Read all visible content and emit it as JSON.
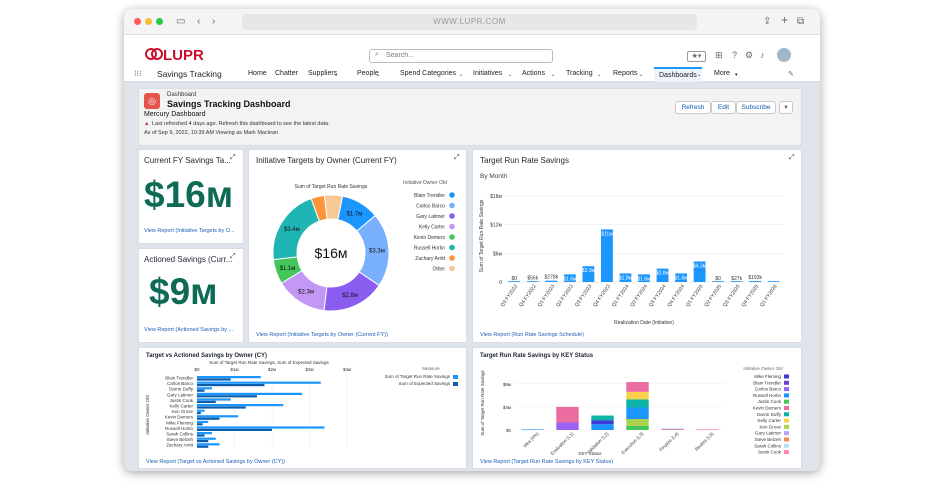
{
  "browser": {
    "url": "WWW.LUPR.COM"
  },
  "header": {
    "logo": "LUPR",
    "search_placeholder": "Search..."
  },
  "nav": {
    "app_name": "Savings Tracking",
    "items": [
      "Home",
      "Chatter",
      "Suppliers",
      "People",
      "Spend Categories",
      "Initiatives",
      "Actions",
      "Tracking",
      "Reports",
      "Dashboards",
      "More"
    ]
  },
  "dashboard": {
    "type_label": "Dashboard",
    "title": "Savings Tracking Dashboard",
    "subtitle": "Mercury Dashboard",
    "warning": "Last refreshed 4 days ago. Refresh this dashboard to see the latest data.",
    "as_of": "As of Sep 9, 2022, 10:39 AM Viewing as Mark Maclean",
    "buttons": {
      "refresh": "Refresh",
      "edit": "Edit",
      "subscribe": "Subscribe"
    }
  },
  "cards": {
    "fy": {
      "title": "Current FY Savings Ta...",
      "value": "$16м",
      "link": "View Report (Initiative Targets by O..."
    },
    "actioned": {
      "title": "Actioned Savings (Curr...",
      "value": "$9м",
      "link": "View Report (Actioned Savings by ..."
    },
    "donut": {
      "title": "Initiative Targets by Owner (Current FY)",
      "link": "View Report (Initiative Targets by Owner (Current FY))"
    },
    "runrate": {
      "title": "Target Run Rate Savings",
      "link": "View Report (Run Rate Savings Schedule)"
    },
    "tva": {
      "title": "Target vs Actioned Savings by Owner (CY)",
      "link": "View Report (Target vs Actioned Savings by Owner (CY))"
    },
    "key": {
      "title": "Target Run Rate Savings by KEY Status",
      "link": "View Report (Target Run Rate Savings by KEY Status)"
    }
  },
  "chart_data": [
    {
      "type": "pie",
      "title": "Sum of Target Run Rate Savings",
      "center_label": "$16м",
      "legend_title": "Initiative Owner Old",
      "categories": [
        "Blain Trendler",
        "Carlos Barco",
        "Gary Latimer",
        "Kelly Carter",
        "Kevin Demers",
        "Russell Hortin",
        "Zachary Arritt",
        "Other"
      ],
      "values": [
        1.7,
        3.3,
        2.8,
        2.3,
        1.1,
        3.4,
        0.6,
        0.8
      ],
      "data_labels": [
        "$1.7м",
        "$3.3м",
        "$2.8м",
        "$2.3м",
        "$1.1м",
        "$3.4м",
        "",
        ""
      ],
      "colors": [
        "#1b96ff",
        "#78b0fd",
        "#8a5cf0",
        "#c398f5",
        "#45c65a",
        "#20b5b5",
        "#fe9339",
        "#f7c795"
      ]
    },
    {
      "type": "bar",
      "subtitle": "By Month",
      "ylabel": "Sum of Target Run Rate Savings",
      "xlabel": "Realization Date (Initiative)",
      "ylim": [
        0,
        18
      ],
      "yticks": [
        "0",
        "$6м",
        "$12м",
        "$18м"
      ],
      "categories": [
        "Q3 FY2022",
        "Q4 FY2022",
        "Q1 FY2023",
        "Q2 FY2023",
        "Q3 FY2023",
        "Q4 FY2023",
        "Q1 FY2024",
        "Q2 FY2024",
        "Q3 FY2024",
        "Q4 FY2024",
        "Q1 FY2025",
        "Q2 FY2025",
        "Q3 FY2025",
        "Q4 FY2025",
        "Q1 FY2026"
      ],
      "values": [
        0,
        0.056,
        0.278,
        1.6,
        3.3,
        11,
        1.8,
        1.6,
        2.8,
        1.8,
        4.3,
        0,
        0.027,
        0.193,
        0
      ],
      "data_labels": [
        "$0",
        "$56k",
        "$278k",
        "$1.6м",
        "$3.3м",
        "$11м",
        "$1.8м",
        "$1.6м",
        "$2.8м",
        "$1.8м",
        "$4.3м",
        "$0",
        "$27k",
        "$193k",
        ""
      ]
    },
    {
      "type": "bar",
      "orientation": "horizontal",
      "title": "Sum of Target Run Rate Savings, Sum of Expected Savings",
      "legend_title": "Measure",
      "ylabel": "Initiative Owner Old",
      "xticks": [
        "$0",
        "$1м",
        "$2м",
        "$3м",
        "$4м"
      ],
      "categories": [
        "Blain Trendler",
        "Carlos Barco",
        "Darrin Duffy",
        "Gary Latimer",
        "Justin Cook",
        "Kelly Carter",
        "Ken Grove",
        "Kevin Demers",
        "Mike Fleming",
        "Russell Hortin",
        "Sarah Collins",
        "Steve Belzeh",
        "Zachary Arritt"
      ],
      "series": [
        {
          "name": "Sum of Target Run Rate Savings",
          "values": [
            1.7,
            3.3,
            0.4,
            2.8,
            0.9,
            2.3,
            0.2,
            1.1,
            0.3,
            3.4,
            0.4,
            0.5,
            0.6
          ]
        },
        {
          "name": "Sum of Expected Savings",
          "values": [
            0.9,
            1.8,
            0.2,
            1.6,
            0.5,
            1.3,
            0.1,
            0.6,
            0.15,
            2.0,
            0.2,
            0.3,
            0.3
          ]
        }
      ],
      "colors": [
        "#1b96ff",
        "#0b5cab"
      ]
    },
    {
      "type": "bar",
      "stacked": true,
      "ylabel": "Sum of Target Run Rate Savings",
      "xlabel": "KEY Status",
      "yticks": [
        "$0",
        "$4м",
        "$8м"
      ],
      "legend_title": "Initiative Owner Old",
      "categories": [
        "Idea (0%)",
        "Evaluation (L1)",
        "Validation (L2)",
        "Execution (L3)",
        "Finalize (L4)",
        "Realize (L5)"
      ],
      "series_names": [
        "Mike Fleming",
        "Blain Trendler",
        "Carlos Barco",
        "Russell Hortin",
        "Justin Cook",
        "Kevin Demers",
        "Darrin Duffy",
        "Kelly Carter",
        "Ken Grove",
        "Gary Latimer",
        "Steve Belzeh",
        "Sarah Collins",
        "Justin Cook"
      ],
      "totals": [
        0.1,
        4.0,
        2.5,
        8.3,
        0.3,
        0.1
      ]
    }
  ]
}
